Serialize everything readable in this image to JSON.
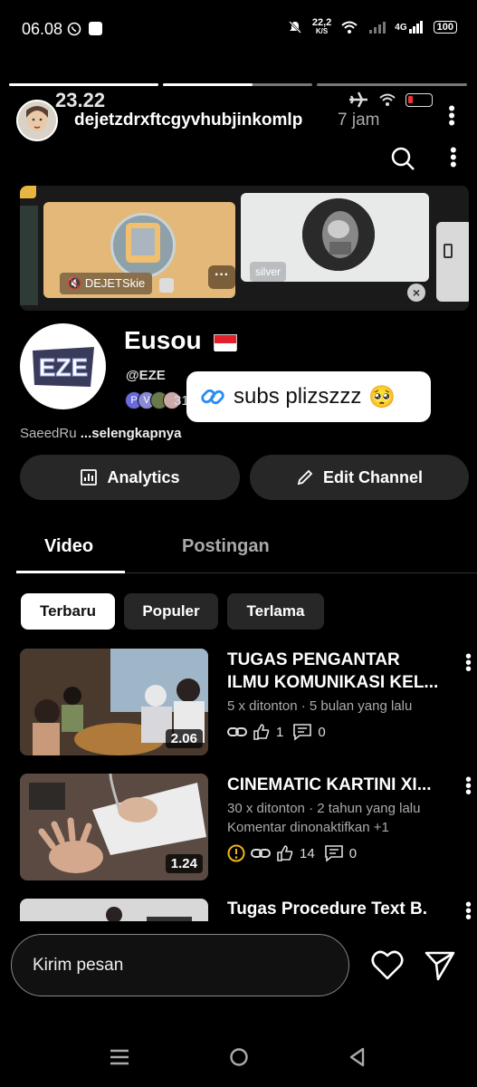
{
  "status_bar": {
    "time": "06.08",
    "speed": "22,2",
    "speed_unit": "K/S",
    "network": "4G",
    "battery": "100"
  },
  "story": {
    "progress": [
      1.0,
      1.0,
      0.0
    ],
    "username": "dejetzdrxftcgyvhubjinkomlp",
    "time_ago": "7 jam"
  },
  "inner_status": {
    "time": "23.22"
  },
  "banner": {
    "tag": "DEJETSkie",
    "silver": "silver"
  },
  "channel": {
    "name": "Eusou",
    "handle": "@EZE",
    "subscriber_avatars": [
      "P",
      "V"
    ],
    "subscriber_count": "31",
    "avatar_text": "EZE",
    "description": "SaeedRu",
    "description_more": "...selengkapnya",
    "sticker_text": "subs plizszzz",
    "sticker_emoji": "🥺"
  },
  "buttons": {
    "analytics": "Analytics",
    "edit_channel": "Edit Channel"
  },
  "tabs": [
    "Video",
    "Postingan"
  ],
  "chips": [
    "Terbaru",
    "Populer",
    "Terlama"
  ],
  "videos": [
    {
      "title_line1": "TUGAS PENGANTAR",
      "title_line2": "ILMU KOMUNIKASI KEL...",
      "meta": "5 x ditonton · 5 bulan yang lalu",
      "meta2": "",
      "duration": "2.06",
      "likes": "1",
      "comments": "0"
    },
    {
      "title_line1": "CINEMATIC KARTINI XI...",
      "title_line2": "",
      "meta": "30 x ditonton · 2 tahun yang lalu",
      "meta2": "Komentar dinonaktifkan +1",
      "duration": "1.24",
      "likes": "14",
      "comments": "0"
    },
    {
      "title_line1": "Tugas Procedure Text B.",
      "title_line2": "",
      "meta": "",
      "meta2": "",
      "duration": "",
      "likes": "",
      "comments": ""
    }
  ],
  "reply": {
    "placeholder": "Kirim pesan"
  }
}
